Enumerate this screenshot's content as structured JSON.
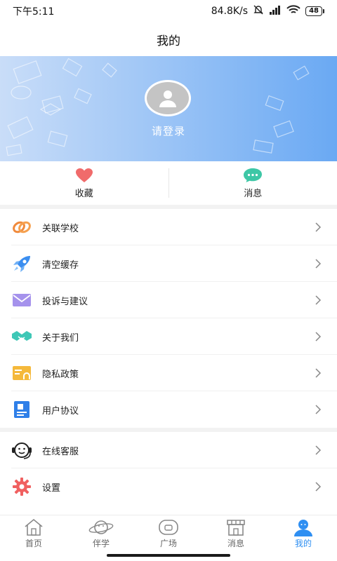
{
  "status_bar": {
    "time": "下午5:11",
    "network_speed": "84.8K/s",
    "battery": "48",
    "icons": [
      "mute-icon",
      "signal-icon",
      "wifi-icon",
      "battery-icon"
    ]
  },
  "header": {
    "title": "我的"
  },
  "profile": {
    "login_text": "请登录",
    "avatar_icon": "user-avatar-icon"
  },
  "quick_actions": [
    {
      "label": "收藏",
      "icon": "heart-icon",
      "color": "#f06b6b"
    },
    {
      "label": "消息",
      "icon": "chat-bubble-icon",
      "color": "#3ec7a6"
    }
  ],
  "menu_groups": [
    [
      {
        "label": "关联学校",
        "icon": "link-icon",
        "color": "#f08a3c"
      },
      {
        "label": "清空缓存",
        "icon": "rocket-icon",
        "color": "#3b8ef0"
      },
      {
        "label": "投诉与建议",
        "icon": "mail-icon",
        "color": "#9b87e8"
      },
      {
        "label": "关于我们",
        "icon": "handshake-icon",
        "color": "#3ec7b6"
      },
      {
        "label": "隐私政策",
        "icon": "card-icon",
        "color": "#f5b93b"
      },
      {
        "label": "用户协议",
        "icon": "document-icon",
        "color": "#2f7fe8"
      }
    ],
    [
      {
        "label": "在线客服",
        "icon": "headset-icon",
        "color": "#222222"
      },
      {
        "label": "设置",
        "icon": "gear-icon",
        "color": "#f06060"
      }
    ]
  ],
  "tab_bar": {
    "active_index": 4,
    "active_color": "#2f8ff2",
    "items": [
      {
        "label": "首页",
        "icon": "home-icon"
      },
      {
        "label": "伴学",
        "icon": "planet-icon"
      },
      {
        "label": "广场",
        "icon": "plaza-icon"
      },
      {
        "label": "消息",
        "icon": "shop-icon"
      },
      {
        "label": "我的",
        "icon": "profile-icon"
      }
    ]
  }
}
